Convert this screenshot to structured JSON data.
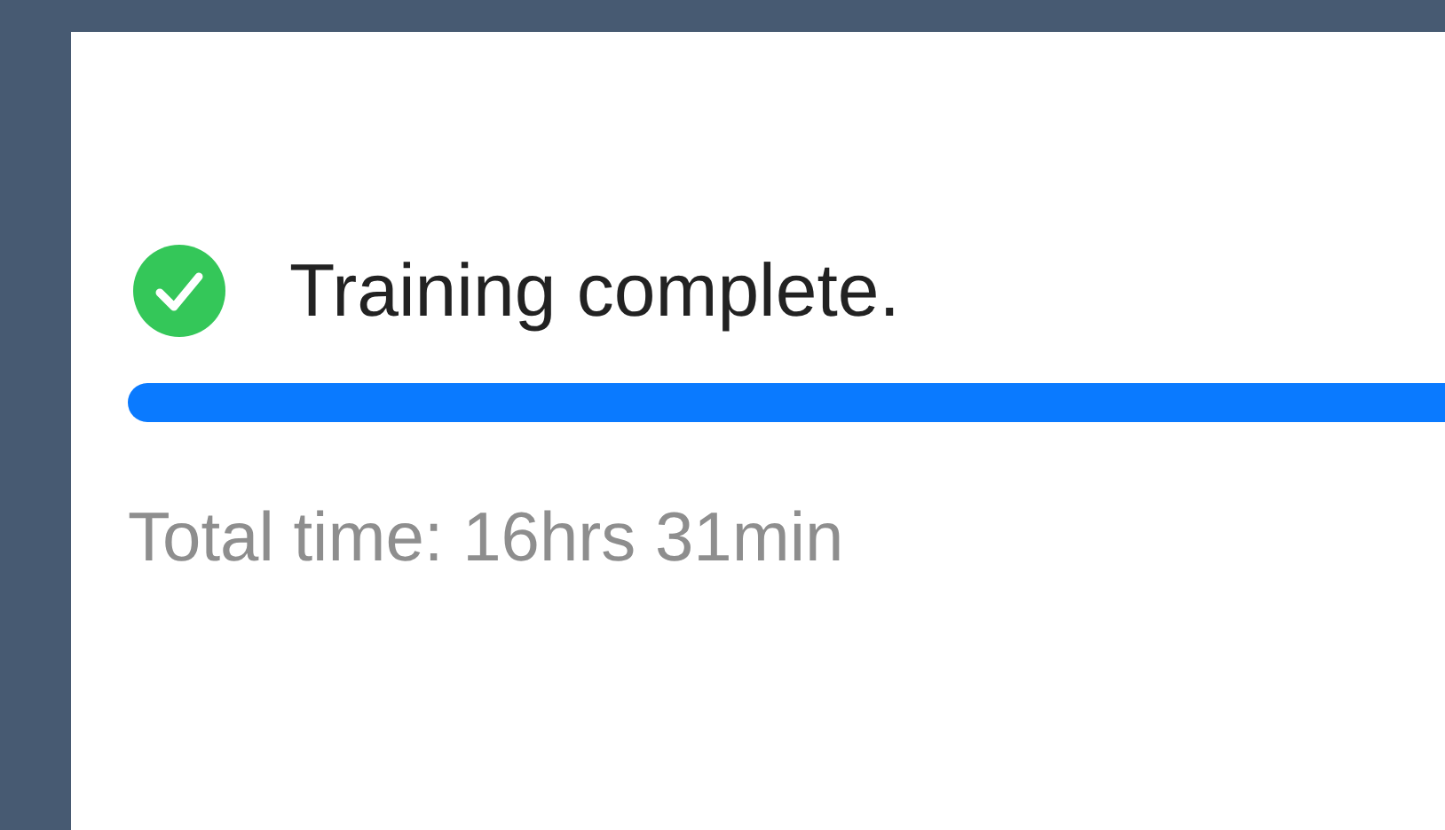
{
  "status": {
    "kind": "complete",
    "message": "Training complete."
  },
  "progress": {
    "level": 1
  },
  "total_time": "Total time: 16hrs 31min"
}
